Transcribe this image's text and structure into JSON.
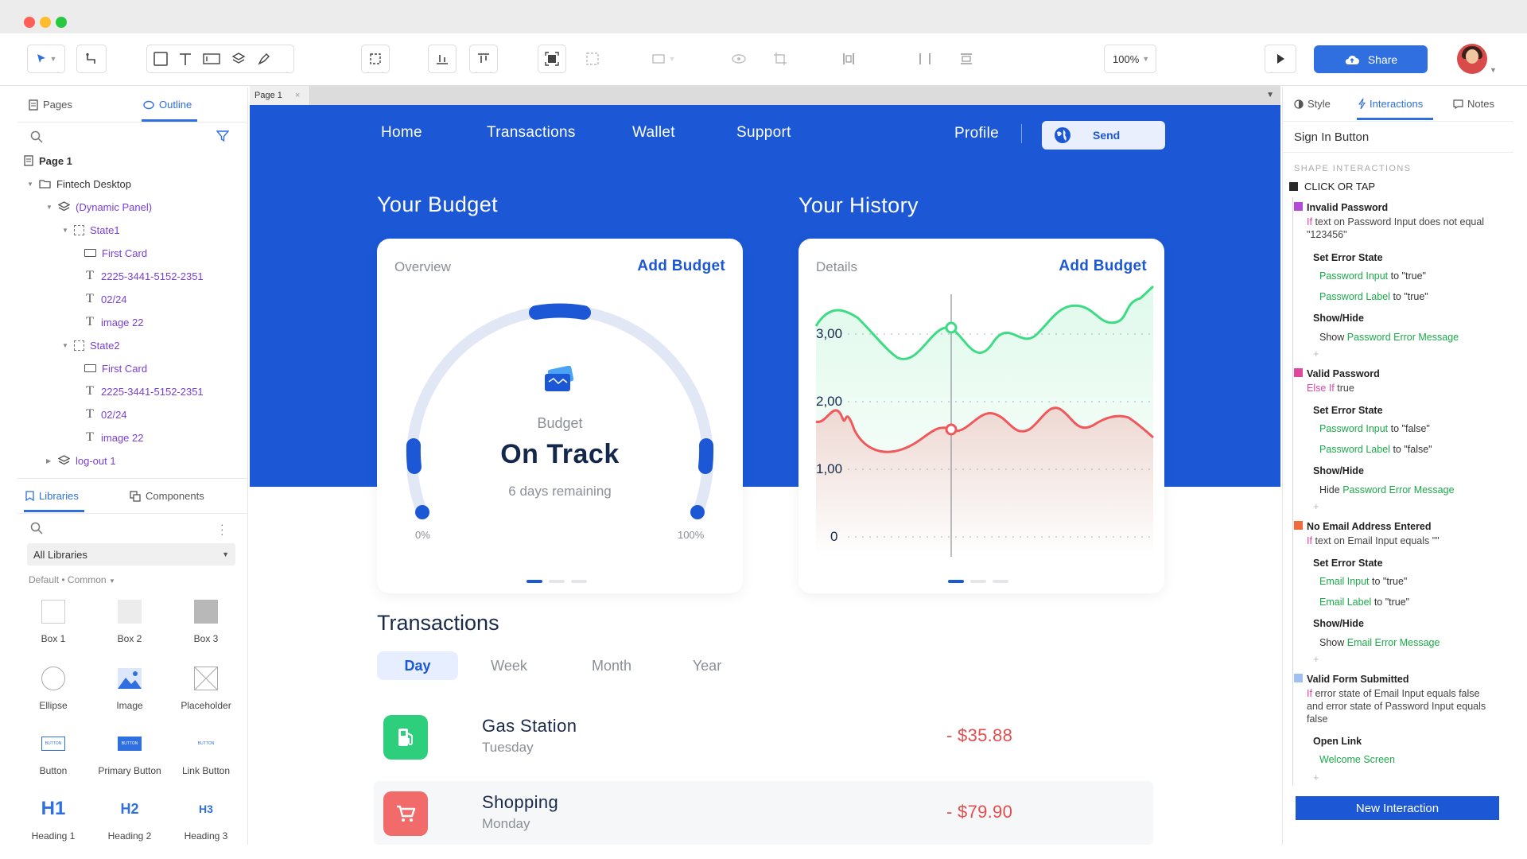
{
  "toolbar": {
    "zoom": "100%",
    "share_label": "Share"
  },
  "left_panel": {
    "tab_pages": "Pages",
    "tab_outline": "Outline",
    "tree": [
      {
        "label": "Page 1"
      },
      {
        "label": "Fintech Desktop"
      },
      {
        "label": "(Dynamic Panel)"
      },
      {
        "label": "State1"
      },
      {
        "label": "First Card"
      },
      {
        "label": "2225-3441-5152-2351"
      },
      {
        "label": "02/24"
      },
      {
        "label": "image 22"
      },
      {
        "label": "State2"
      },
      {
        "label": "First Card"
      },
      {
        "label": "2225-3441-5152-2351"
      },
      {
        "label": "02/24"
      },
      {
        "label": "image 22"
      },
      {
        "label": "log-out 1"
      }
    ],
    "tab_libraries": "Libraries",
    "tab_components": "Components",
    "library_select": "All Libraries",
    "library_breadcrumb_a": "Default",
    "library_breadcrumb_b": "Common",
    "widgets": [
      {
        "label": "Box 1"
      },
      {
        "label": "Box 2"
      },
      {
        "label": "Box 3"
      },
      {
        "label": "Ellipse"
      },
      {
        "label": "Image"
      },
      {
        "label": "Placeholder"
      },
      {
        "label": "Button"
      },
      {
        "label": "Primary Button"
      },
      {
        "label": "Link Button"
      },
      {
        "label": "Heading 1",
        "glyph": "H1"
      },
      {
        "label": "Heading 2",
        "glyph": "H2"
      },
      {
        "label": "Heading 3",
        "glyph": "H3"
      }
    ],
    "button_glyph": "BUTTON"
  },
  "canvas": {
    "page_tab": "Page 1",
    "nav": [
      "Home",
      "Transactions",
      "Wallet",
      "Support"
    ],
    "profile": "Profile",
    "send": "Send",
    "budget_heading": "Your Budget",
    "history_heading": "Your History",
    "budget_card": {
      "label": "Overview",
      "link": "Add Budget",
      "caption": "Budget",
      "status": "On Track",
      "remaining": "6 days remaining",
      "min_label": "0%",
      "max_label": "100%"
    },
    "history_card": {
      "label": "Details",
      "link": "Add Budget",
      "y_ticks": [
        "3,00",
        "2,00",
        "1,00",
        "0"
      ]
    },
    "transactions": {
      "title": "Transactions",
      "tabs": [
        "Day",
        "Week",
        "Month",
        "Year"
      ],
      "rows": [
        {
          "name": "Gas Station",
          "day": "Tuesday",
          "amount": "- $35.88"
        },
        {
          "name": "Shopping",
          "day": "Monday",
          "amount": "- $79.90"
        }
      ]
    }
  },
  "right_panel": {
    "tab_style": "Style",
    "tab_interactions": "Interactions",
    "tab_notes": "Notes",
    "shape_name": "Sign In Button",
    "caption": "SHAPE INTERACTIONS",
    "trigger": "CLICK OR TAP",
    "cases": [
      {
        "title": "Invalid Password",
        "cond_kw": "If",
        "condition": "text on Password Input does not equal \"123456\"",
        "actions": [
          {
            "name": "Set Error State",
            "targets": [
              {
                "t": "Password Input",
                "v": "to \"true\""
              },
              {
                "t": "Password Label",
                "v": "to \"true\""
              }
            ]
          },
          {
            "name": "Show/Hide",
            "targets": [
              {
                "pre": "Show",
                "t": "Password Error Message",
                "v": ""
              }
            ]
          }
        ]
      },
      {
        "title": "Valid Password",
        "cond_kw": "Else If",
        "condition": "true",
        "actions": [
          {
            "name": "Set Error State",
            "targets": [
              {
                "t": "Password Input",
                "v": "to \"false\""
              },
              {
                "t": "Password Label",
                "v": "to \"false\""
              }
            ]
          },
          {
            "name": "Show/Hide",
            "targets": [
              {
                "pre": "Hide",
                "t": "Password Error Message",
                "v": ""
              }
            ]
          }
        ]
      },
      {
        "title": "No Email Address Entered",
        "cond_kw": "If",
        "condition": "text on Email Input equals \"\"",
        "actions": [
          {
            "name": "Set Error State",
            "targets": [
              {
                "t": "Email Input",
                "v": "to \"true\""
              },
              {
                "t": "Email Label",
                "v": "to \"true\""
              }
            ]
          },
          {
            "name": "Show/Hide",
            "targets": [
              {
                "pre": "Show",
                "t": "Email Error Message",
                "v": ""
              }
            ]
          }
        ]
      },
      {
        "title": "Valid Form Submitted",
        "cond_kw": "If",
        "condition": "error state of Email Input equals false and error state of Password Input equals false",
        "actions": [
          {
            "name": "Open Link",
            "targets": [
              {
                "t": "Welcome Screen",
                "v": ""
              }
            ]
          }
        ]
      }
    ],
    "new_interaction": "New Interaction"
  },
  "colors": {
    "brand_blue": "#1c58d6",
    "accent_blue": "#2f6fdf",
    "green_series": "#3ddc84",
    "red_series": "#f0595c",
    "negative_amount": "#e44d4d",
    "case_purple": "#b44bd6",
    "case_pink": "#e0489c",
    "case_orange": "#f06a3c",
    "case_lightblue": "#9fc0f2"
  },
  "icons": {
    "select_tool": "pointer-arrow-icon",
    "connector_tool": "connector-icon",
    "rectangle_tool": "rectangle-icon",
    "text_tool": "text-icon",
    "preview": "play-icon",
    "share": "cloud-upload-icon",
    "gas": "gas-pump-icon",
    "shopping": "cart-icon"
  }
}
